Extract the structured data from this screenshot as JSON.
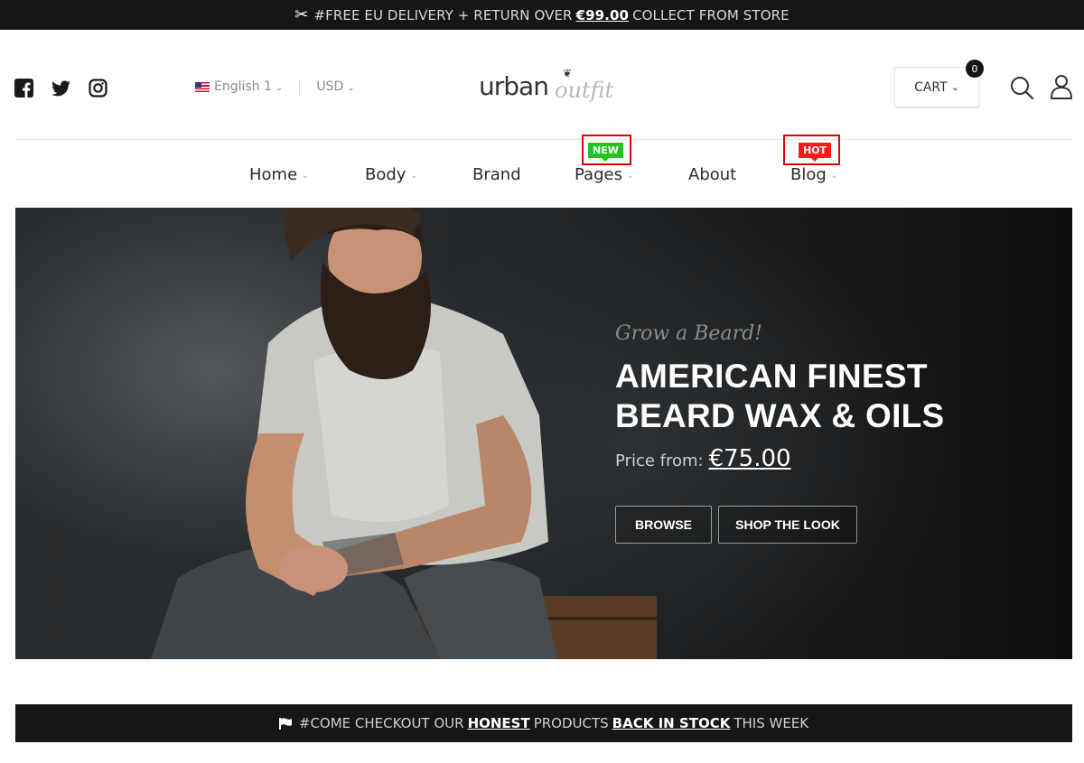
{
  "top_bar": {
    "icon": "scissors-icon",
    "text_before": "#FREE EU DELIVERY + RETURN OVER",
    "link": "€99.00",
    "text_after": "COLLECT FROM STORE"
  },
  "header": {
    "social": [
      "facebook-icon",
      "twitter-icon",
      "instagram-icon"
    ],
    "language": "English 1",
    "currency": "USD",
    "logo_primary": "urban",
    "logo_secondary": "outfit",
    "cart_label": "CART",
    "cart_count": "0"
  },
  "nav": {
    "items": [
      {
        "label": "Home",
        "dropdown": true
      },
      {
        "label": "Body",
        "dropdown": true
      },
      {
        "label": "Brand",
        "dropdown": false
      },
      {
        "label": "Pages",
        "dropdown": true,
        "badge": "NEW"
      },
      {
        "label": "About",
        "dropdown": false
      },
      {
        "label": "Blog",
        "dropdown": true,
        "badge": "HOT"
      }
    ]
  },
  "hero": {
    "script": "Grow a Beard!",
    "title_line1": "AMERICAN FINEST",
    "title_line2": "BEARD WAX & OILS",
    "price_label": "Price from:",
    "price": "€75.00",
    "buttons": [
      "BROWSE",
      "SHOP THE LOOK"
    ]
  },
  "bottom_bar": {
    "icon": "flag-icon",
    "text1": "#COME CHECKOUT OUR",
    "link1": "HONEST",
    "text2": "PRODUCTS",
    "link2": "BACK IN STOCK",
    "text3": "THIS WEEK"
  },
  "colors": {
    "dark": "#161616",
    "badge_new": "#1fc41f",
    "badge_hot": "#ff1a1a",
    "highlight_outline": "#e00000"
  }
}
